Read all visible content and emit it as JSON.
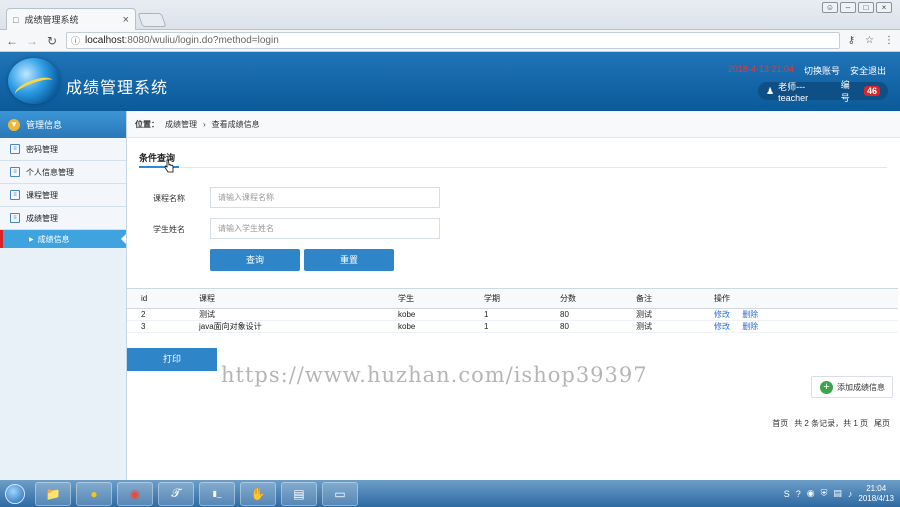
{
  "browser": {
    "tab_title": "成绩管理系统",
    "url_host": "localhost",
    "url_rest": ":8080/wuliu/login.do?method=login"
  },
  "header": {
    "title": "成绩管理系统",
    "date": "2018-4-13 21:04",
    "switch_account": "切换账号",
    "logout": "安全退出",
    "user_label": "老师---teacher",
    "id_label": "编号",
    "id_value": "46"
  },
  "sidebar": {
    "header": "管理信息",
    "items": [
      {
        "label": "密码管理"
      },
      {
        "label": "个人信息管理"
      },
      {
        "label": "课程管理"
      },
      {
        "label": "成绩管理"
      }
    ],
    "active_sub": "成绩信息"
  },
  "breadcrumb": {
    "prefix": "位置：",
    "level1": "成绩管理",
    "sep": "›",
    "level2": "查看成绩信息"
  },
  "query": {
    "title": "条件查询",
    "course_label": "课程名称",
    "course_placeholder": "请输入课程名称",
    "student_label": "学生姓名",
    "student_placeholder": "请输入学生姓名",
    "search_btn": "查询",
    "reset_btn": "重置"
  },
  "table": {
    "headers": [
      "id",
      "课程",
      "学生",
      "学期",
      "分数",
      "备注",
      "操作"
    ],
    "rows": [
      {
        "id": "2",
        "course": "测试",
        "student": "kobe",
        "term": "1",
        "score": "80",
        "note": "测试",
        "edit": "修改",
        "del": "删除"
      },
      {
        "id": "3",
        "course": "java面向对象设计",
        "student": "kobe",
        "term": "1",
        "score": "80",
        "note": "测试",
        "edit": "修改",
        "del": "删除"
      }
    ]
  },
  "actions": {
    "print": "打印",
    "add": "添加成绩信息"
  },
  "pager": {
    "first": "首页",
    "summary": "共 2 条记录，共 1 页",
    "last": "尾页"
  },
  "watermark": "https://www.huzhan.com/ishop39397",
  "taskbar": {
    "time": "21:04",
    "date": "2018/4/13"
  }
}
